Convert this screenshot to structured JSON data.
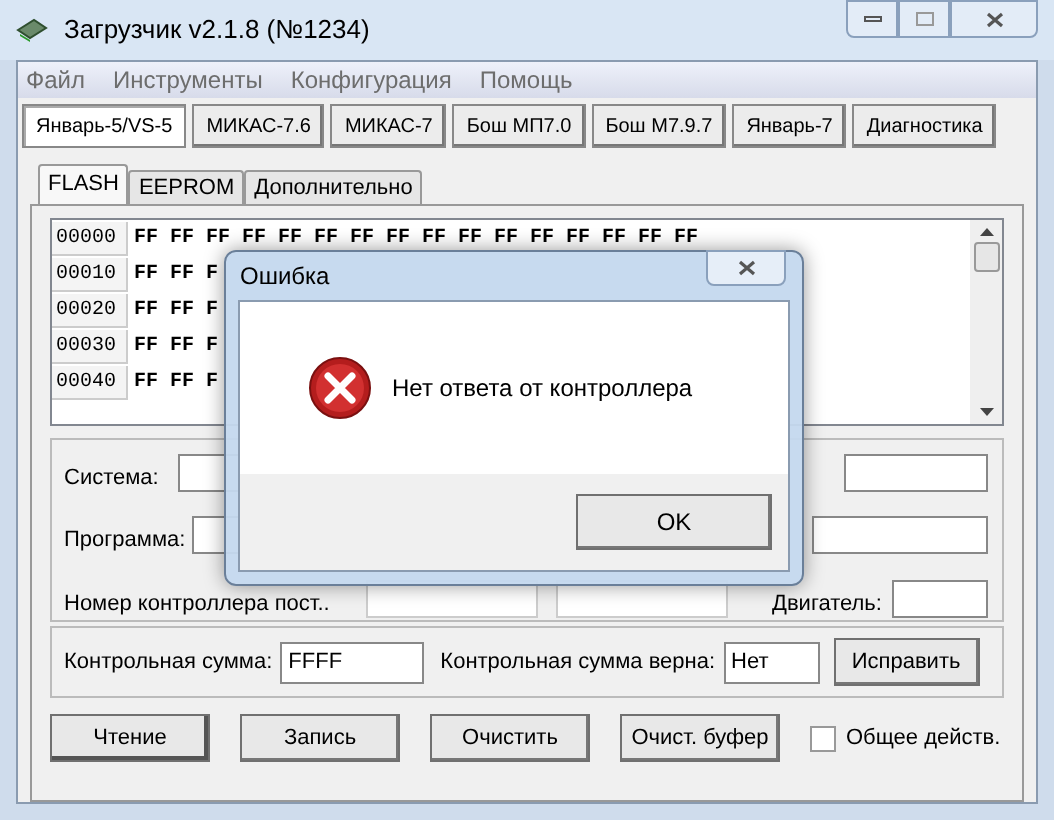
{
  "window": {
    "title": "Загрузчик v2.1.8 (№1234)"
  },
  "menu": [
    "Файл",
    "Инструменты",
    "Конфигурация",
    "Помощь"
  ],
  "device_tabs": [
    {
      "label": "Январь-5/VS-5",
      "selected": true
    },
    {
      "label": "МИКАС-7.6",
      "selected": false
    },
    {
      "label": "МИКАС-7",
      "selected": false
    },
    {
      "label": "Бош МП7.0",
      "selected": false
    },
    {
      "label": "Бош М7.9.7",
      "selected": false
    },
    {
      "label": "Январь-7",
      "selected": false
    },
    {
      "label": "Диагностика",
      "selected": false
    }
  ],
  "sub_tabs": [
    {
      "label": "FLASH",
      "selected": true
    },
    {
      "label": "EEPROM",
      "selected": false
    },
    {
      "label": "Дополнительно",
      "selected": false
    }
  ],
  "hex_rows": [
    {
      "address": "00000",
      "data": "FF FF FF FF FF FF FF FF FF FF FF FF FF FF FF FF"
    },
    {
      "address": "00010",
      "data": "FF FF F"
    },
    {
      "address": "00020",
      "data": "FF FF F"
    },
    {
      "address": "00030",
      "data": "FF FF F"
    },
    {
      "address": "00040",
      "data": "FF FF F"
    }
  ],
  "info": {
    "system_label": "Система:",
    "program_label": "Программа:",
    "controller_label": "Номер контроллера пост..",
    "engine_label": "Двигатель:"
  },
  "checksum": {
    "label": "Контрольная сумма:",
    "value": "FFFF",
    "valid_label": "Контрольная сумма верна:",
    "valid_value": "Нет",
    "fix_button": "Исправить"
  },
  "buttons": [
    "Чтение",
    "Запись",
    "Очистить",
    "Очист. буфер"
  ],
  "common_action": {
    "label": "Общее действ.",
    "checked": false
  },
  "dialog": {
    "title": "Ошибка",
    "message": "Нет ответа от контроллера",
    "button": "OK"
  }
}
